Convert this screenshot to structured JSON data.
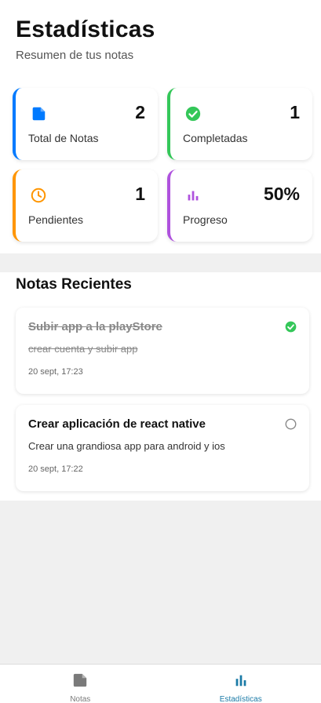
{
  "header": {
    "title": "Estadísticas",
    "subtitle": "Resumen de tus notas"
  },
  "stats": [
    {
      "label": "Total de Notas",
      "value": "2",
      "icon": "note-icon",
      "color": "#007aff"
    },
    {
      "label": "Completadas",
      "value": "1",
      "icon": "check-circle-icon",
      "color": "#34c759"
    },
    {
      "label": "Pendientes",
      "value": "1",
      "icon": "clock-icon",
      "color": "#ff9500"
    },
    {
      "label": "Progreso",
      "value": "50%",
      "icon": "bar-chart-icon",
      "color": "#af52de"
    }
  ],
  "recent": {
    "title": "Notas Recientes",
    "notes": [
      {
        "title": "Subir app a la playStore",
        "description": "crear cuenta y subir app",
        "date": "20 sept, 17:23",
        "completed": true
      },
      {
        "title": "Crear aplicación de react native",
        "description": "Crear una grandiosa app para android y ios",
        "date": "20 sept, 17:22",
        "completed": false
      }
    ]
  },
  "tabs": [
    {
      "label": "Notas",
      "icon": "note-icon",
      "active": false
    },
    {
      "label": "Estadísticas",
      "icon": "bar-chart-icon",
      "active": true
    }
  ],
  "colors": {
    "active_tab": "#1a7aa6",
    "inactive_tab": "#7a7a7a"
  }
}
